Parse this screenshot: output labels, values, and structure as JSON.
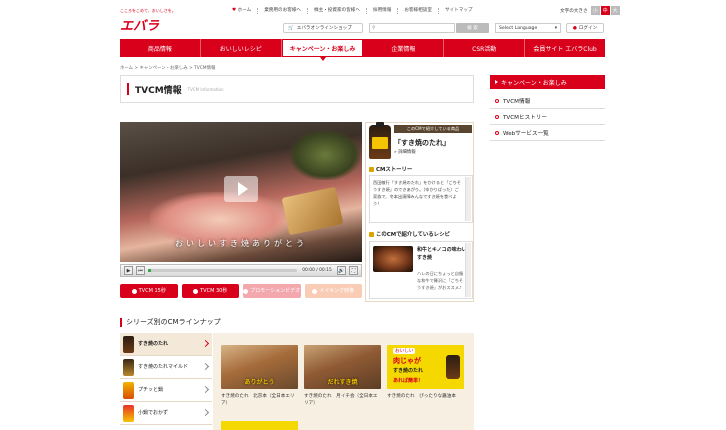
{
  "header": {
    "tagline": "こころをこめて、おいしさを。",
    "brand": "エバラ",
    "top_links": [
      "ホーム",
      "業務用のお客様へ",
      "株主・投資家の皆様へ",
      "採用情報",
      "お客様相談室",
      "サイトマップ"
    ],
    "font_size_label": "文字の大きさ",
    "font_sizes": [
      "小",
      "中",
      "大"
    ],
    "shop_label": "エバラオンラインショップ",
    "search_placeholder": "",
    "search_button": "検 索",
    "language_select": "Select Language",
    "login": "ログイン"
  },
  "nav": {
    "items": [
      "商品情報",
      "おいしいレシピ",
      "キャンペーン・お楽しみ",
      "企業情報",
      "CSR活動",
      "会員サイト エバラClub"
    ],
    "active_index": 2
  },
  "breadcrumb": "ホーム > キャンペーン・お楽しみ > TVCM情報",
  "page": {
    "title": "TVCM情報",
    "subtitle": "TVCM Information"
  },
  "video": {
    "caption": "おいしいすき焼ありがとう",
    "timer": "00:00 / 00:15",
    "progress": 0.02
  },
  "cm_buttons": [
    "TVCM 15秒",
    "TVCM 30秒",
    "プロモーションビデオ",
    "メイキング映像"
  ],
  "product": {
    "header": "このCMで紹介している商品",
    "name": "「すき焼のたれ」",
    "detail": "» 詳細情報"
  },
  "story": {
    "title": "CMストーリー",
    "text": "西田敏行「すき焼のたれ」をかけると「ごちそうすき焼」のできあがり。（ゆかりばった）ご家族で、冬本出演陣みんなですき焼を食べよう！"
  },
  "recipe": {
    "title": "このCMで紹介しているレシピ",
    "name": "和牛とキノコの味わいすき焼",
    "desc": "ハレの日にちょっと自慢な和牛で贅沢に「ごちそうすき焼」がおススメ♪"
  },
  "series": {
    "title": "シリーズ別のCMラインナップ",
    "items": [
      "すき焼のたれ",
      "すき焼のたれマイルド",
      "プチッと鍋",
      "小鍋でおかず"
    ],
    "active_index": 0,
    "thumbs": [
      {
        "caption": "ありがとう",
        "label": "すき焼のたれ　北京本（全日本エリア）"
      },
      {
        "caption": "だれすき焼",
        "label": "すき焼のたれ　月イチ会（全日本エリア）"
      },
      {
        "caption": "",
        "label": "すき焼のたれ　ぴったりな醤油本"
      }
    ],
    "ad_text": {
      "line1": "おいしい",
      "line2": "肉じゃが",
      "line3": "すき焼のたれ",
      "line4": "あれば簡単！"
    }
  },
  "sidebar": {
    "header": "キャンペーン・お楽しみ",
    "items": [
      "TVCM情報",
      "TVCMヒストリー",
      "Webサービス一覧"
    ]
  }
}
